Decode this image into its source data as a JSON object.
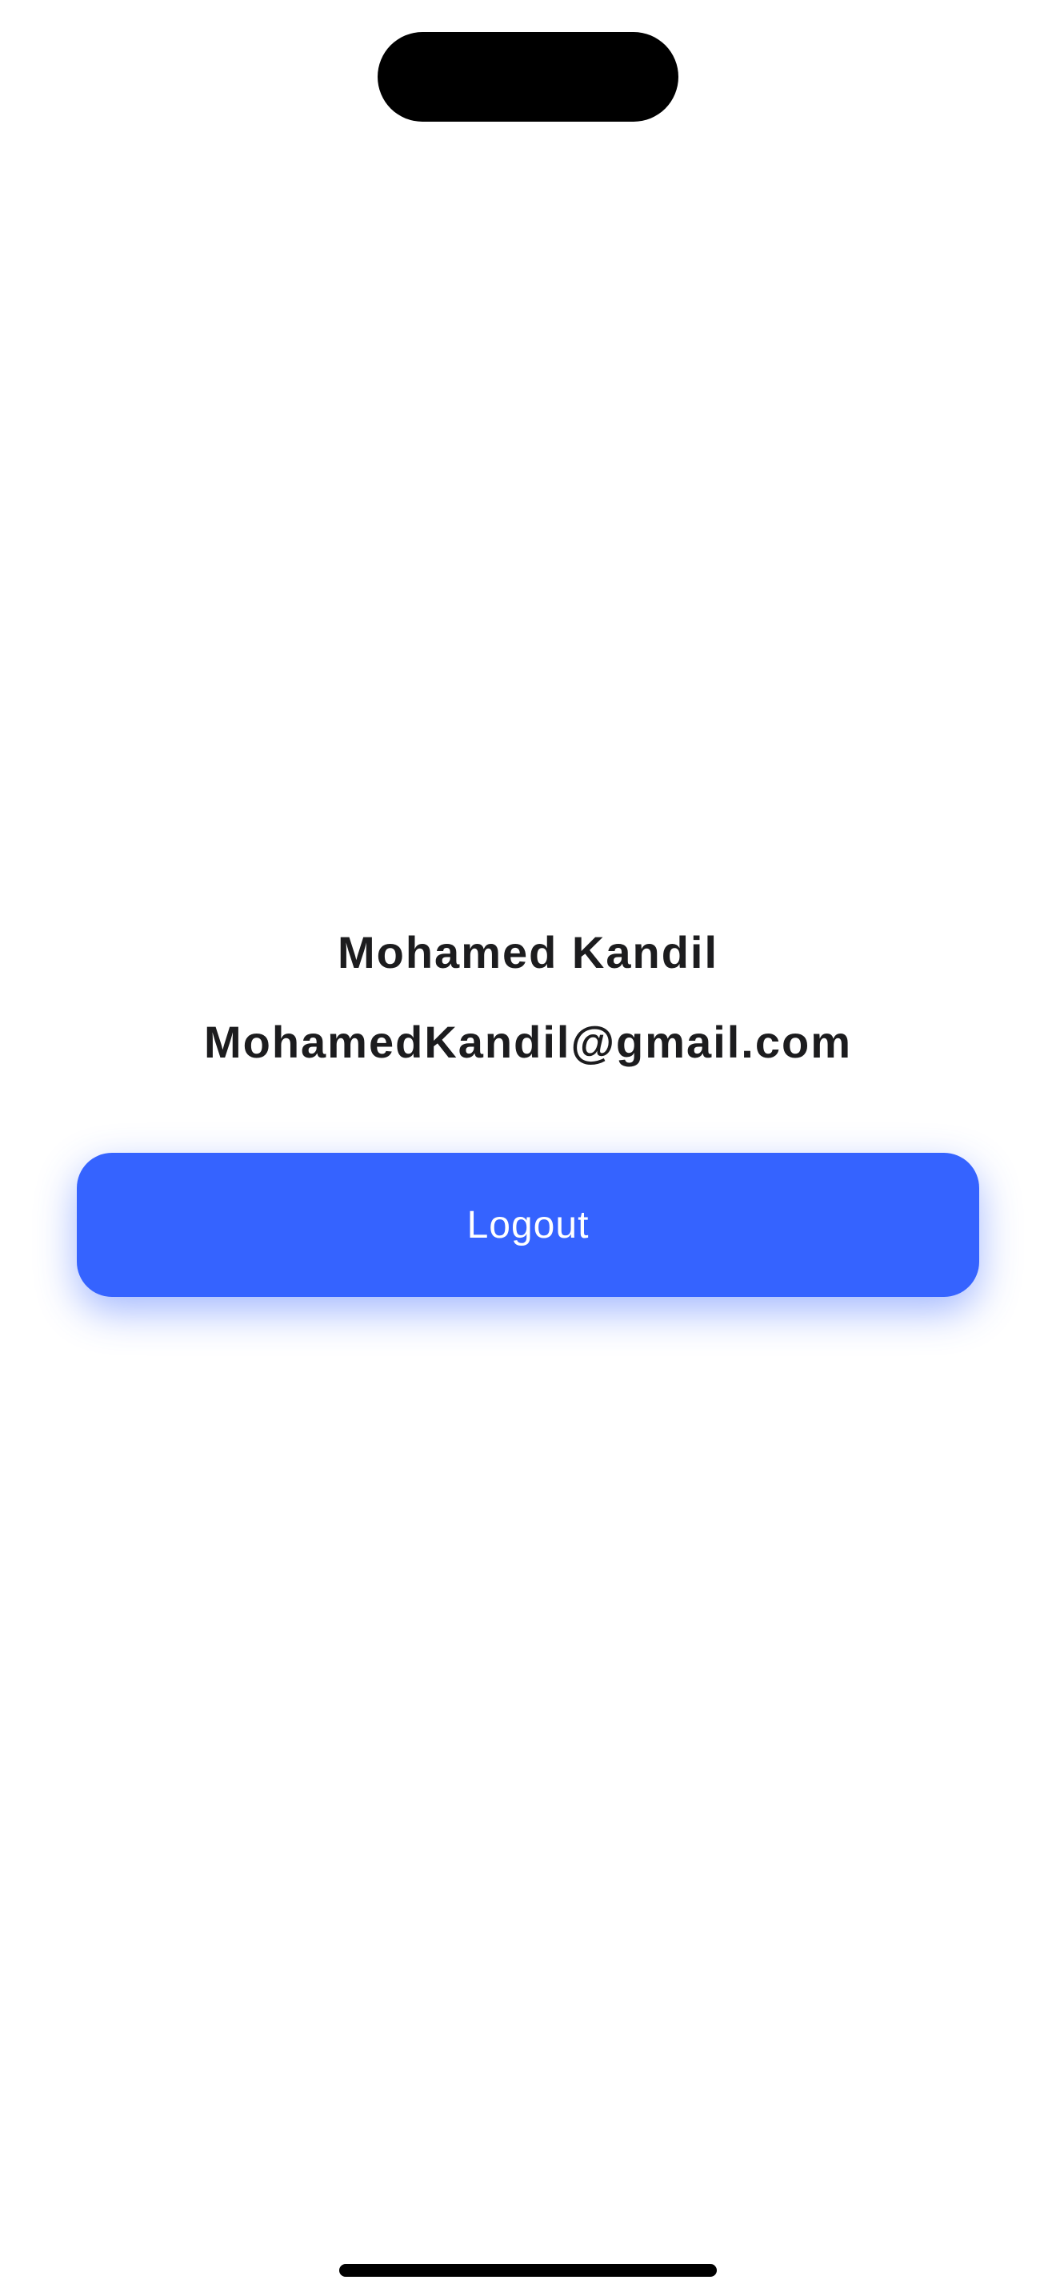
{
  "profile": {
    "name": "Mohamed Kandil",
    "email": "MohamedKandil@gmail.com"
  },
  "actions": {
    "logout_label": "Logout"
  },
  "colors": {
    "accent": "#3563ff",
    "text": "#1c1c1e",
    "background": "#ffffff"
  }
}
